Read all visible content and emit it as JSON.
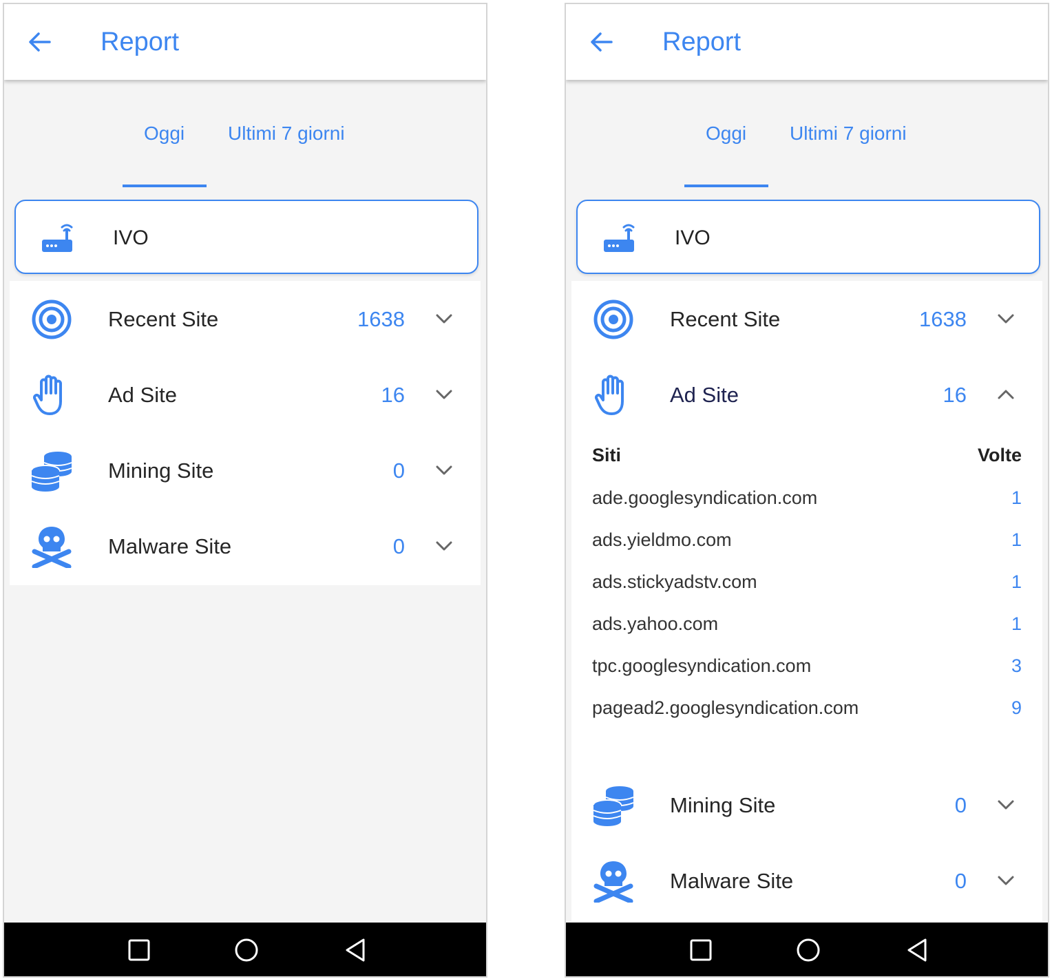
{
  "colors": {
    "accent": "#3d86f0",
    "background": "#f4f4f4",
    "navbar": "#000000"
  },
  "screens": [
    {
      "header": {
        "title": "Report",
        "back_icon": "arrow-left-icon"
      },
      "tabs": [
        {
          "label": "Oggi"
        },
        {
          "label": "Ultimi 7 giorni"
        }
      ],
      "selected_tab": "Oggi",
      "device": {
        "name": "IVO",
        "icon": "router-icon"
      },
      "categories": [
        {
          "label": "Recent Site",
          "count": "1638",
          "icon": "target-icon",
          "expanded": false
        },
        {
          "label": "Ad Site",
          "count": "16",
          "icon": "hand-icon",
          "expanded": false
        },
        {
          "label": "Mining Site",
          "count": "0",
          "icon": "coins-icon",
          "expanded": false
        },
        {
          "label": "Malware Site",
          "count": "0",
          "icon": "skull-icon",
          "expanded": false
        }
      ]
    },
    {
      "header": {
        "title": "Report",
        "back_icon": "arrow-left-icon"
      },
      "tabs": [
        {
          "label": "Oggi"
        },
        {
          "label": "Ultimi 7 giorni"
        }
      ],
      "selected_tab": "Oggi",
      "device": {
        "name": "IVO",
        "icon": "router-icon"
      },
      "categories": [
        {
          "label": "Recent Site",
          "count": "1638",
          "icon": "target-icon",
          "expanded": false
        },
        {
          "label": "Ad Site",
          "count": "16",
          "icon": "hand-icon",
          "expanded": true
        },
        {
          "label": "Mining Site",
          "count": "0",
          "icon": "coins-icon",
          "expanded": false
        },
        {
          "label": "Malware Site",
          "count": "0",
          "icon": "skull-icon",
          "expanded": false
        }
      ],
      "ad_site_detail": {
        "column_sites": "Siti",
        "column_times": "Volte",
        "rows": [
          {
            "site": "ade.googlesyndication.com",
            "times": "1"
          },
          {
            "site": "ads.yieldmo.com",
            "times": "1"
          },
          {
            "site": "ads.stickyadstv.com",
            "times": "1"
          },
          {
            "site": "ads.yahoo.com",
            "times": "1"
          },
          {
            "site": "tpc.googlesyndication.com",
            "times": "3"
          },
          {
            "site": "pagead2.googlesyndication.com",
            "times": "9"
          }
        ]
      }
    }
  ],
  "navbar": {
    "buttons": [
      "recents-square-icon",
      "home-circle-icon",
      "back-triangle-icon"
    ]
  }
}
